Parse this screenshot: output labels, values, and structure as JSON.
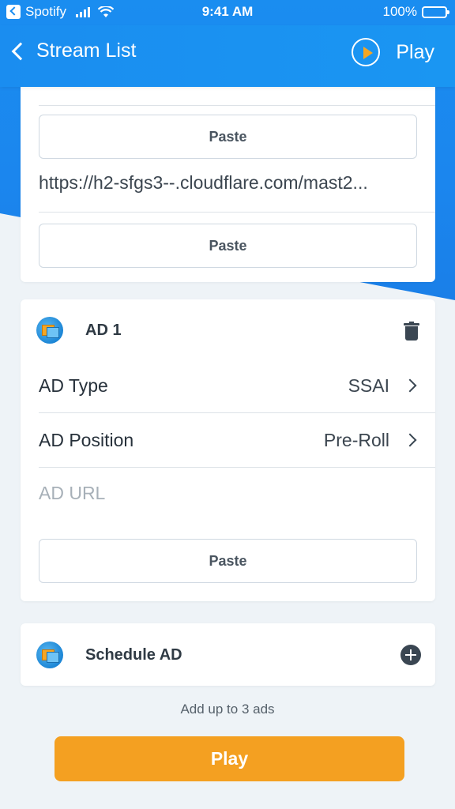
{
  "status_bar": {
    "carrier": "Spotify",
    "time": "9:41 AM",
    "battery": "100%"
  },
  "nav": {
    "back_label": "Stream List",
    "play_label": "Play"
  },
  "top_card": {
    "paste_label_1": "Paste",
    "url_value": "https://h2-sfgs3--.cloudflare.com/mast2...",
    "paste_label_2": "Paste"
  },
  "ad_card": {
    "title": "AD 1",
    "rows": [
      {
        "label": "AD Type",
        "value": "SSAI"
      },
      {
        "label": "AD Position",
        "value": "Pre-Roll"
      }
    ],
    "url_placeholder": "AD URL",
    "paste_label": "Paste"
  },
  "schedule": {
    "label": "Schedule AD",
    "hint": "Add up to 3 ads"
  },
  "footer": {
    "play_label": "Play"
  },
  "colors": {
    "primary_blue": "#1a8df0",
    "accent_orange": "#f4a021",
    "background": "#eef3f7"
  },
  "icons": [
    "back-app-icon",
    "signal-icon",
    "wifi-icon",
    "battery-icon",
    "chevron-left-icon",
    "play-circle-icon",
    "ad-logo-icon",
    "trash-icon",
    "chevron-right-icon",
    "add-icon"
  ]
}
